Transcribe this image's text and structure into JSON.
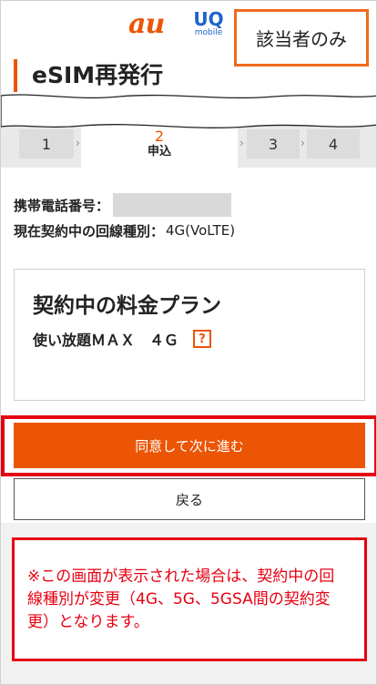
{
  "header": {
    "logo_au": "au",
    "logo_uq": "UQ",
    "logo_uq_sub": "mobile",
    "tag": "該当者のみ"
  },
  "page": {
    "title": "eSIM再発行"
  },
  "steps": {
    "s1": "1",
    "s2_num": "2",
    "s2_label": "申込",
    "s3": "3",
    "s4": "4",
    "current": 2
  },
  "info": {
    "phone_label": "携帯電話番号：",
    "line_type_label": "現在契約中の回線種別：",
    "line_type_value": "4G(VoLTE)"
  },
  "plan": {
    "title": "契約中の料金プラン",
    "name": "使い放題ＭＡＸ　４Ｇ",
    "help_glyph": "?"
  },
  "buttons": {
    "agree": "同意して次に進む",
    "back": "戻る"
  },
  "note": {
    "text": "※この画面が表示された場合は、契約中の回線種別が変更（4G、5G、5GSA間の契約変更）となります。"
  },
  "colors": {
    "brand_orange": "#eb5505",
    "highlight_red": "#e60012",
    "uq_blue": "#1e64c8"
  }
}
